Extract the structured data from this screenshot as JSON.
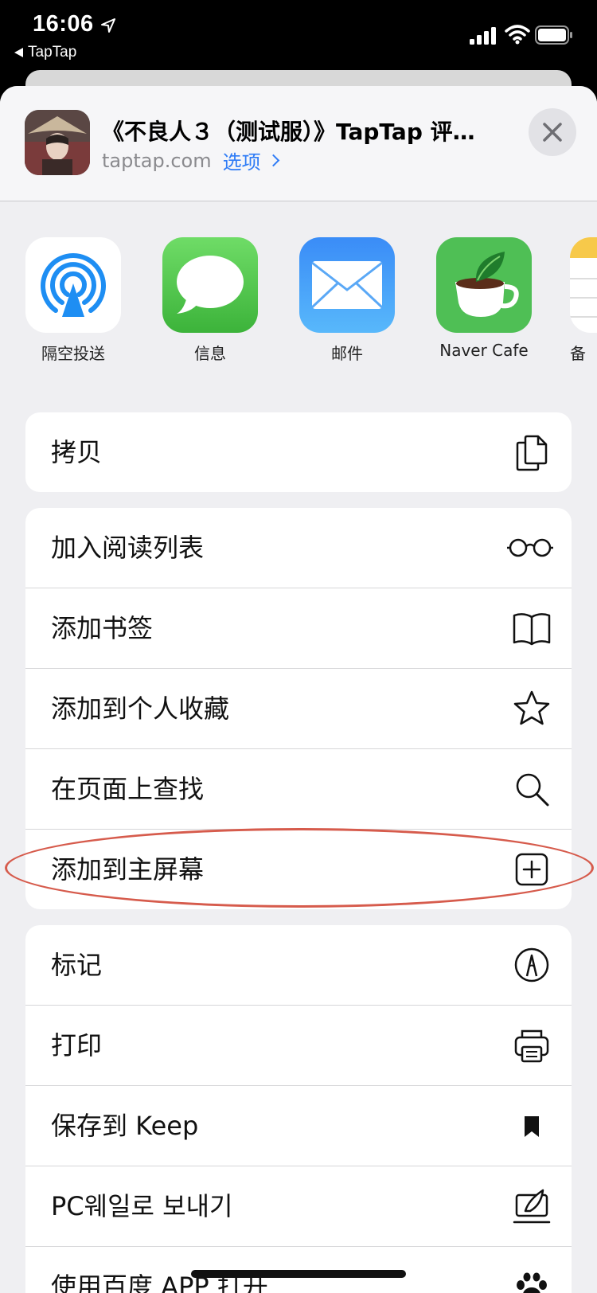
{
  "status_bar": {
    "time": "16:06",
    "back_app": "TapTap"
  },
  "share_header": {
    "title": "《不良人３（测试服）》TapTap 评…",
    "domain": "taptap.com",
    "options_label": "选项"
  },
  "apps": [
    {
      "label": "隔空投送",
      "icon": "airdrop-icon"
    },
    {
      "label": "信息",
      "icon": "messages-icon"
    },
    {
      "label": "邮件",
      "icon": "mail-icon"
    },
    {
      "label": "Naver Cafe",
      "icon": "naver-cafe-icon"
    },
    {
      "label": "备",
      "icon": "notes-icon"
    }
  ],
  "actions": {
    "group1": [
      {
        "label": "拷贝",
        "icon": "copy-icon"
      }
    ],
    "group2": [
      {
        "label": "加入阅读列表",
        "icon": "glasses-icon"
      },
      {
        "label": "添加书签",
        "icon": "book-icon"
      },
      {
        "label": "添加到个人收藏",
        "icon": "star-icon"
      },
      {
        "label": "在页面上查找",
        "icon": "search-icon"
      },
      {
        "label": "添加到主屏幕",
        "icon": "add-square-icon"
      }
    ],
    "group3": [
      {
        "label": "标记",
        "icon": "markup-icon"
      },
      {
        "label": "打印",
        "icon": "printer-icon"
      },
      {
        "label": "保存到 Keep",
        "icon": "bookmark-icon"
      },
      {
        "label": "PC웨일로 보내기",
        "icon": "whale-send-icon"
      },
      {
        "label": "使用百度 APP 打开",
        "icon": "paw-icon"
      }
    ]
  },
  "colors": {
    "accent": "#2f7cf6",
    "highlight": "#d65b4c",
    "sheet_bg": "#efeff2"
  }
}
